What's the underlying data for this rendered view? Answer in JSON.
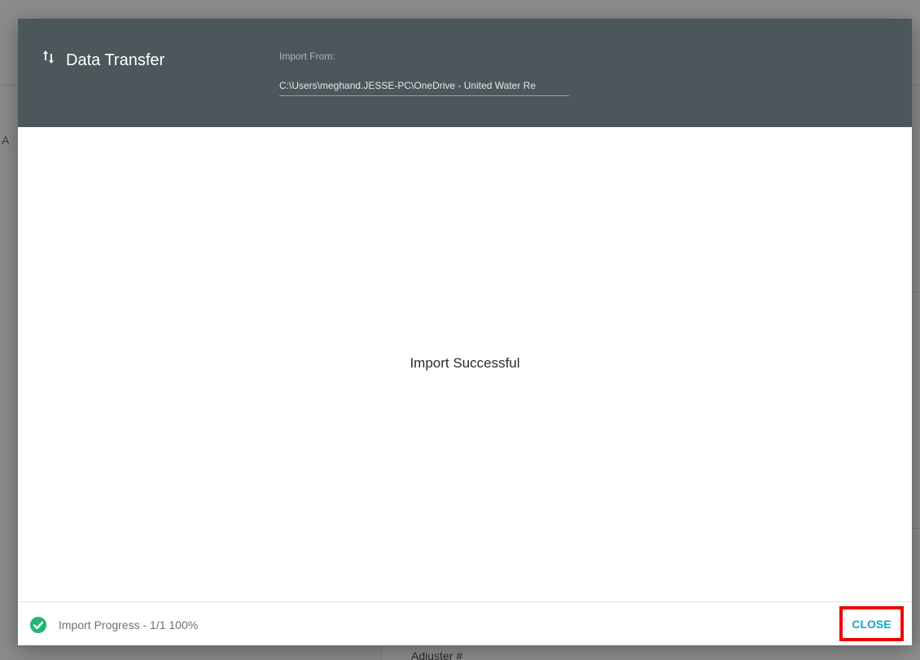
{
  "background": {
    "left_glyph": "A",
    "bottom_field_label": "Adjuster #"
  },
  "dialog": {
    "title": "Data Transfer",
    "title_icon": "swap-vertical-icon",
    "import_from_label": "Import From:",
    "import_from_value": "C:\\Users\\meghand.JESSE-PC\\OneDrive - United Water Re",
    "message": "Import Successful",
    "footer": {
      "status_icon": "check-circle-icon",
      "progress_text": "Import Progress - 1/1  100%",
      "close_label": "CLOSE"
    }
  },
  "colors": {
    "header_bg": "#4b575b",
    "accent": "#1aa3c8",
    "success": "#22b573",
    "highlight": "#ee0000"
  }
}
